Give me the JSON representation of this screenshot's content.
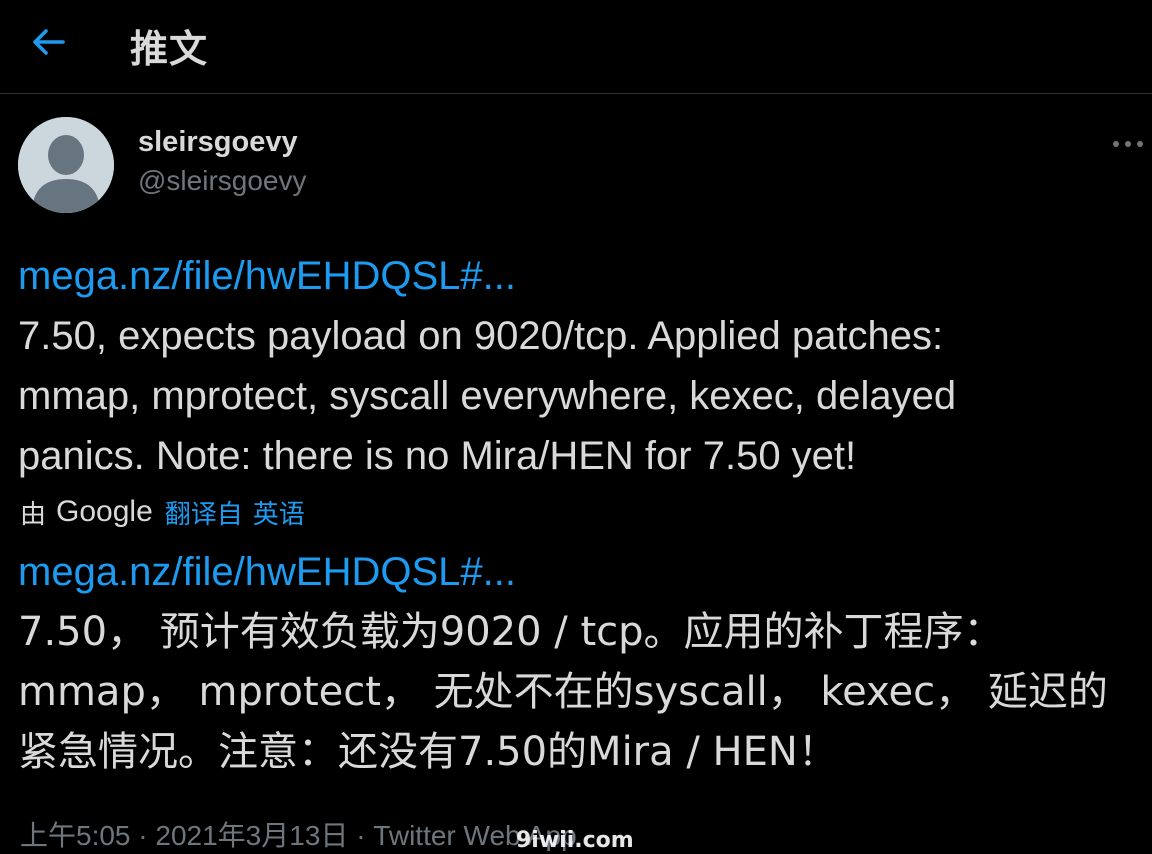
{
  "header": {
    "back_icon": "arrow-left-icon",
    "title": "推文",
    "accent_color": "#1d9bf0"
  },
  "author": {
    "display_name": "sleirsgoevy",
    "handle": "@sleirsgoevy",
    "avatar_icon": "default-avatar-icon",
    "more_icon": "more-horizontal-icon"
  },
  "tweet": {
    "link_text": "mega.nz/file/hwEHDQSL#...",
    "lines": [
      "7.50, expects payload on 9020/tcp. Applied patches:",
      "mmap, mprotect, syscall everywhere, kexec, delayed",
      "panics. Note: there is no Mira/HEN for 7.50 yet!"
    ]
  },
  "translation": {
    "by_label": "由",
    "provider": "Google",
    "translated_from": "翻译自",
    "language": "英语",
    "link_text": "mega.nz/file/hwEHDQSL#...",
    "lines": [
      "7.50， 预计有效负载为9020 / tcp。应用的补丁程序：",
      "mmap， mprotect， 无处不在的syscall， kexec， 延迟的",
      "紧急情况。注意：还没有7.50的Mira / HEN！"
    ]
  },
  "meta": {
    "time": "上午5:05",
    "separator": "·",
    "date": "2021年3月13日",
    "app": "Twitter Web App"
  },
  "watermark": "9iwii.com"
}
